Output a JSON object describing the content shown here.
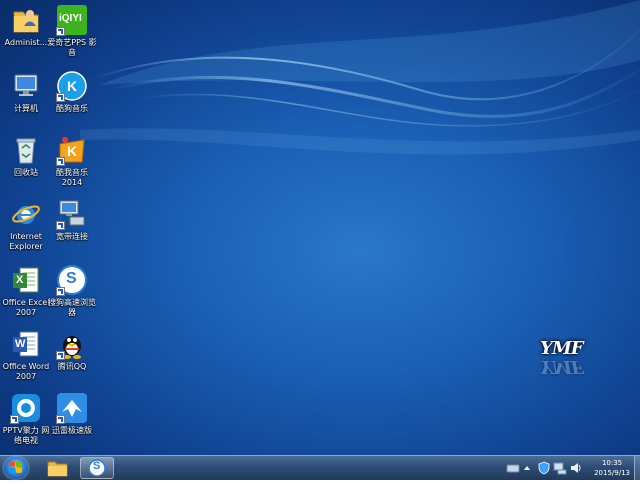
{
  "desktop": {
    "icons": [
      {
        "name": "administrator-folder",
        "icon": "user-folder-icon",
        "label": "Administ..."
      },
      {
        "name": "iqiyi-pps",
        "icon": "iqiyi-icon",
        "label": "爱奇艺PPS 影音",
        "brand": "iQIYI"
      },
      {
        "name": "computer",
        "icon": "computer-icon",
        "label": "计算机"
      },
      {
        "name": "kugou-music",
        "icon": "kugou-icon",
        "label": "酷狗音乐",
        "brand": "K"
      },
      {
        "name": "recycle-bin",
        "icon": "recycle-bin-icon",
        "label": "回收站"
      },
      {
        "name": "kuwo-music",
        "icon": "kuwo-icon",
        "label": "酷我音乐 2014",
        "brand": "K"
      },
      {
        "name": "internet-explorer",
        "icon": "ie-icon",
        "label": "Internet Explorer"
      },
      {
        "name": "broadband-connection",
        "icon": "network-icon",
        "label": "宽带连接"
      },
      {
        "name": "office-excel",
        "icon": "excel-icon",
        "label": "Office Excel 2007",
        "brand": "X"
      },
      {
        "name": "sogou-browser",
        "icon": "sogou-icon",
        "label": "搜狗高速浏览器",
        "brand": "S"
      },
      {
        "name": "office-word",
        "icon": "word-icon",
        "label": "Office Word 2007",
        "brand": "W"
      },
      {
        "name": "tencent-qq",
        "icon": "qq-icon",
        "label": "腾讯QQ"
      },
      {
        "name": "pptv",
        "icon": "pptv-icon",
        "label": "PPTV聚力 网络电视"
      },
      {
        "name": "xunlei-browser",
        "icon": "xunlei-icon",
        "label": "迅雷极速版"
      }
    ],
    "watermark": "YMF"
  },
  "taskbar": {
    "pinned": [
      {
        "name": "explorer",
        "icon": "folder-icon"
      },
      {
        "name": "sogou",
        "icon": "sogou-icon",
        "brand": "S"
      }
    ],
    "clock": {
      "time": "10:35",
      "date": "2015/9/13"
    }
  },
  "colors": {
    "accent": "#1a5fb4",
    "taskbar": "#2e4d74"
  }
}
